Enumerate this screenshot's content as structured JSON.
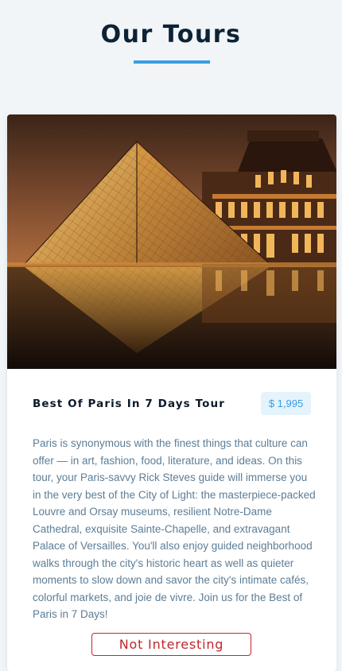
{
  "page": {
    "title": "Our Tours",
    "accent_color": "#3a9de0",
    "title_color": "#0d2235",
    "background_color": "#f1f5f8"
  },
  "tours": [
    {
      "image": {
        "subject": "Louvre glass pyramid and palace reflected at night",
        "icon": "louvre-photo"
      },
      "name": "Best Of Paris In 7 Days Tour",
      "price": "$ 1,995",
      "info": "Paris is synonymous with the finest things that culture can offer — in art, fashion, food, literature, and ideas. On this tour, your Paris-savvy Rick Steves guide will immerse you in the very best of the City of Light: the masterpiece-packed Louvre and Orsay museums, resilient Notre-Dame Cathedral, exquisite Sainte-Chapelle, and extravagant Palace of Versailles. You'll also enjoy guided neighborhood walks through the city's historic heart as well as quieter moments to slow down and savor the city's intimate cafés, colorful markets, and joie de vivre. Join us for the Best of Paris in 7 Days!",
      "remove_label": "Not Interesting",
      "remove_color": "#c0262c"
    }
  ]
}
